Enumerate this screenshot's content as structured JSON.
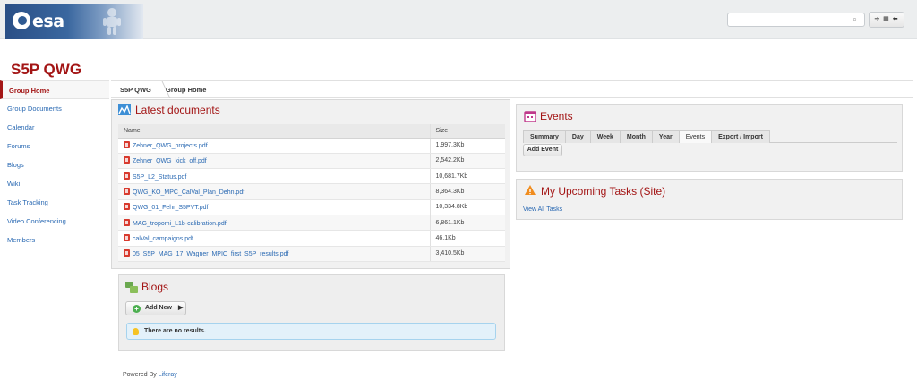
{
  "header": {
    "logo_text": "esa",
    "search_placeholder": "",
    "dock_label": "➔ ▦ ⬅"
  },
  "site_title": "S5P QWG",
  "nav": {
    "items": [
      {
        "label": "Group Home",
        "active": true
      },
      {
        "label": "Group Documents"
      },
      {
        "label": "Calendar"
      },
      {
        "label": "Forums"
      },
      {
        "label": "Blogs"
      },
      {
        "label": "Wiki"
      },
      {
        "label": "Task Tracking"
      },
      {
        "label": "Video Conferencing"
      },
      {
        "label": "Members"
      }
    ]
  },
  "breadcrumb": [
    "S5P QWG",
    "Group Home"
  ],
  "documents": {
    "title": "Latest documents",
    "columns": [
      "Name",
      "Size"
    ],
    "rows": [
      {
        "name": "Zehner_QWG_projects.pdf",
        "size": "1,997.3Kb"
      },
      {
        "name": "Zehner_QWG_kick_off.pdf",
        "size": "2,542.2Kb"
      },
      {
        "name": "S5P_L2_Status.pdf",
        "size": "10,681.7Kb"
      },
      {
        "name": "QWG_KO_MPC_CalVal_Plan_Dehn.pdf",
        "size": "8,364.3Kb"
      },
      {
        "name": "QWG_01_Fehr_S5PVT.pdf",
        "size": "10,334.8Kb"
      },
      {
        "name": "MAG_tropomi_L1b-calibration.pdf",
        "size": "6,861.1Kb"
      },
      {
        "name": "calVal_campaigns.pdf",
        "size": "46.1Kb"
      },
      {
        "name": "05_S5P_MAG_17_Wagner_MPIC_first_S5P_results.pdf",
        "size": "3,410.5Kb"
      }
    ]
  },
  "blogs": {
    "title": "Blogs",
    "add_new": "Add New",
    "empty_message": "There are no results."
  },
  "events": {
    "title": "Events",
    "tabs": [
      "Summary",
      "Day",
      "Week",
      "Month",
      "Year",
      "Events",
      "Export / Import"
    ],
    "selected_tab": "Events",
    "add_event": "Add Event"
  },
  "tasks": {
    "title": "My Upcoming Tasks (Site)",
    "view_all": "View All Tasks"
  },
  "footer": {
    "powered_by": "Powered By",
    "link": "Liferay"
  },
  "colors": {
    "title_red": "#a31515",
    "link_blue": "#2b6ab3"
  }
}
